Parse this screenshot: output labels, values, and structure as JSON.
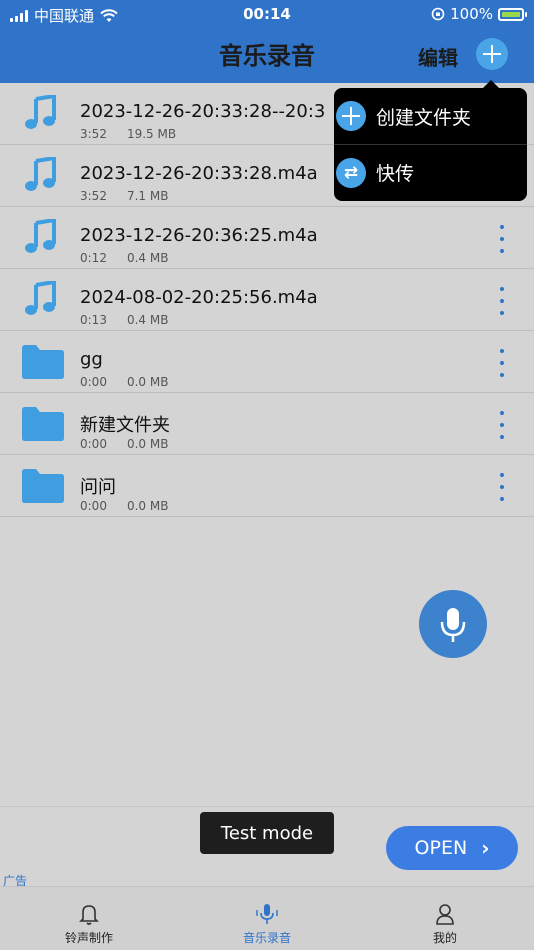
{
  "status_bar": {
    "carrier": "中国联通",
    "time": "00:14",
    "battery_percent": "100%"
  },
  "header": {
    "title": "音乐录音",
    "edit_label": "编辑"
  },
  "popup_menu": {
    "items": [
      {
        "label": "创建文件夹",
        "icon": "add-circle-icon"
      },
      {
        "label": "快传",
        "icon": "swap-icon"
      }
    ]
  },
  "files": [
    {
      "type": "audio",
      "name": "2023-12-26-20:33:28--20:3",
      "duration": "3:52",
      "size": "19.5 MB"
    },
    {
      "type": "audio",
      "name": "2023-12-26-20:33:28.m4a",
      "duration": "3:52",
      "size": "7.1 MB"
    },
    {
      "type": "audio",
      "name": "2023-12-26-20:36:25.m4a",
      "duration": "0:12",
      "size": "0.4 MB"
    },
    {
      "type": "audio",
      "name": "2024-08-02-20:25:56.m4a",
      "duration": "0:13",
      "size": "0.4 MB"
    },
    {
      "type": "folder",
      "name": "gg",
      "duration": "0:00",
      "size": "0.0 MB"
    },
    {
      "type": "folder",
      "name": "新建文件夹",
      "duration": "0:00",
      "size": "0.0 MB"
    },
    {
      "type": "folder",
      "name": "问问",
      "duration": "0:00",
      "size": "0.0 MB"
    }
  ],
  "ad": {
    "label": "广告",
    "test_mode": "Test mode",
    "open_button": "OPEN"
  },
  "tabbar": {
    "tabs": [
      {
        "label": "铃声制作",
        "icon": "bell-icon",
        "active": false
      },
      {
        "label": "音乐录音",
        "icon": "microphone-icon",
        "active": true
      },
      {
        "label": "我的",
        "icon": "user-icon",
        "active": false
      }
    ]
  },
  "colors": {
    "header_bg": "#2f74c9",
    "accent": "#4aa5e8",
    "popup_bg": "#000000",
    "open_button": "#3b7de2"
  }
}
